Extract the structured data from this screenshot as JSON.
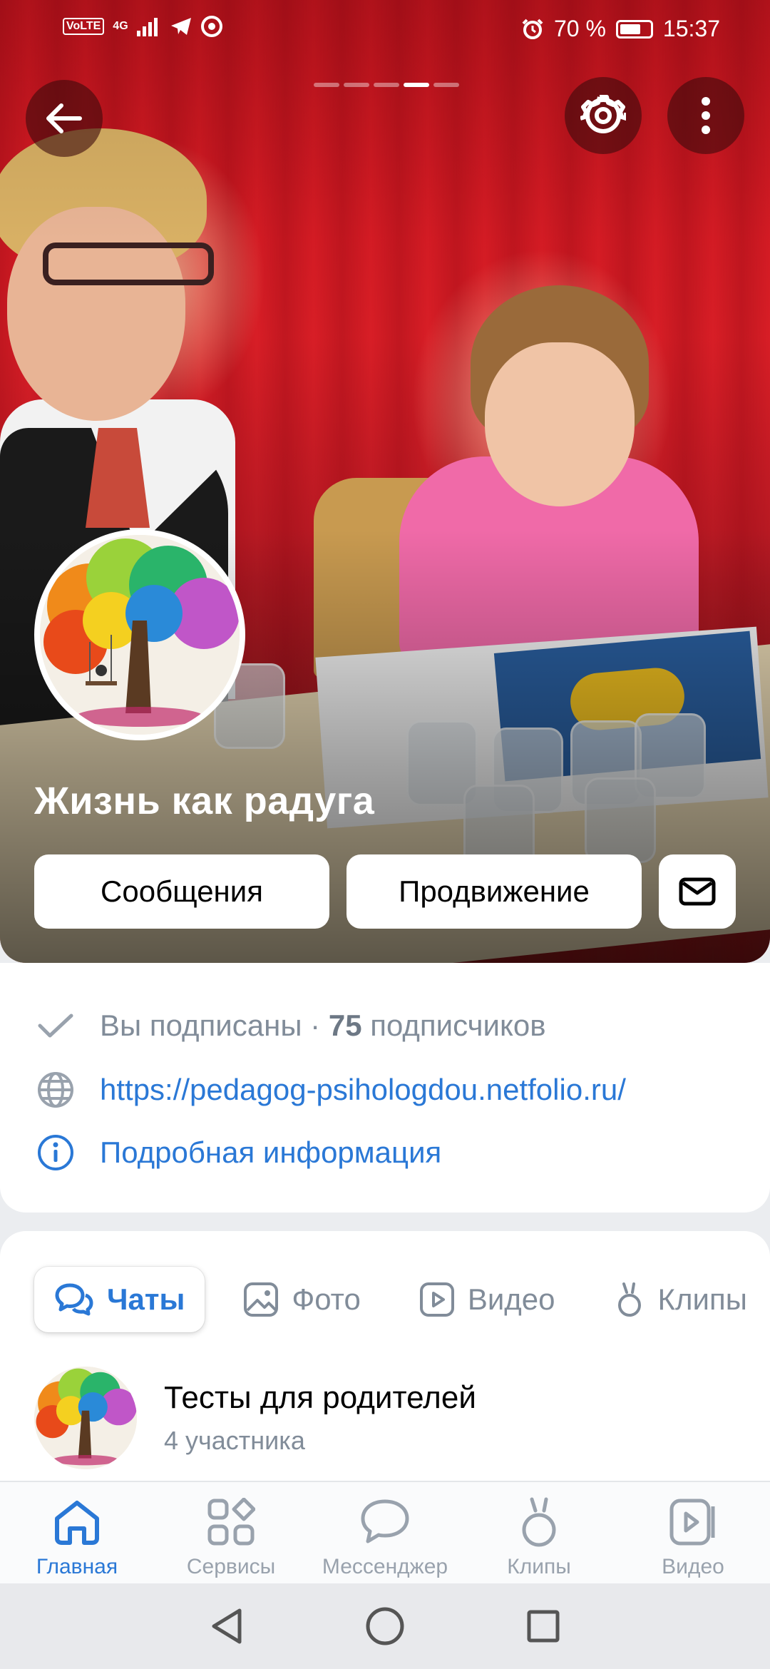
{
  "status_bar": {
    "network_badge": "VoLTE",
    "network_type": "4G",
    "battery": "70 %",
    "battery_level": 0.7,
    "time": "15:37"
  },
  "cover": {
    "slides_count": 5,
    "active_slide": 4,
    "group_name": "Жизнь как радуга",
    "actions": {
      "messages": "Сообщения",
      "promotion": "Продвижение"
    }
  },
  "info": {
    "subscribed": "Вы подписаны",
    "separator": "·",
    "followers_count": "75",
    "followers_label": "подписчиков",
    "website": "https://pedagog-psihologdou.netfolio.ru/",
    "details": "Подробная информация"
  },
  "tabs": [
    {
      "label": "Чаты",
      "icon": "chat-icon"
    },
    {
      "label": "Фото",
      "icon": "photo-icon"
    },
    {
      "label": "Видео",
      "icon": "video-icon"
    },
    {
      "label": "Клипы",
      "icon": "clips-icon"
    }
  ],
  "chat_list": [
    {
      "title": "Тесты для родителей",
      "members": "4 участника"
    }
  ],
  "bottom_nav": [
    {
      "label": "Главная",
      "icon": "home-icon"
    },
    {
      "label": "Сервисы",
      "icon": "services-icon"
    },
    {
      "label": "Мессенджер",
      "icon": "messenger-icon"
    },
    {
      "label": "Клипы",
      "icon": "clips-icon"
    },
    {
      "label": "Видео",
      "icon": "video-icon"
    }
  ],
  "colors": {
    "accent": "#2a78d6",
    "secondary_text": "#818c99",
    "background": "#ebedf0"
  }
}
